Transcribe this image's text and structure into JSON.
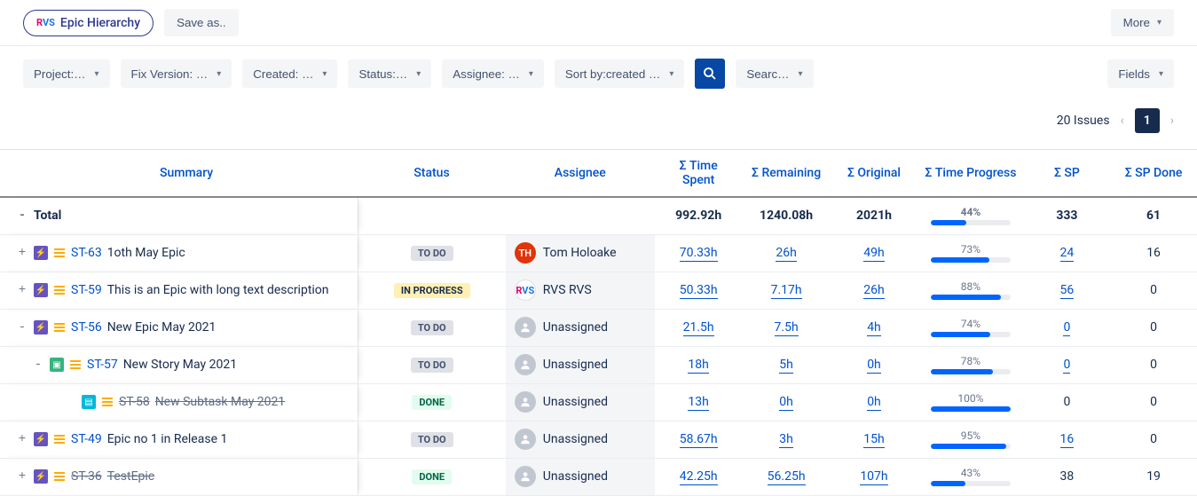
{
  "toolbar": {
    "title": "Epic Hierarchy",
    "saveas": "Save as..",
    "more": "More"
  },
  "filters": {
    "project": "Project:…",
    "fixversion": "Fix Version: …",
    "created": "Created: …",
    "status": "Status:…",
    "assignee": "Assignee: …",
    "sortby": "Sort by:created …",
    "search": "Searc…",
    "fields": "Fields"
  },
  "pagination": {
    "count": "20 Issues",
    "page": "1"
  },
  "headers": {
    "summary": "Summary",
    "status": "Status",
    "assignee": "Assignee",
    "timespent": "Σ Time Spent",
    "remaining": "Σ Remaining",
    "original": "Σ Original",
    "progress": "Σ Time Progress",
    "sp": "Σ SP",
    "spdone": "Σ SP Done"
  },
  "totals": {
    "label": "Total",
    "timespent": "992.92h",
    "remaining": "1240.08h",
    "original": "2021h",
    "progress": "44%",
    "progress_val": 44,
    "sp": "333",
    "spdone": "61"
  },
  "rows": [
    {
      "expander": "+",
      "indent": 0,
      "type": "epic",
      "key": "ST-63",
      "strike_key": false,
      "summary": "1oth May Epic",
      "strike_summary": false,
      "status": "TO DO",
      "status_kind": "todo",
      "assignee": "Tom Holoake",
      "avatar": "TH",
      "avatar_kind": "th",
      "timespent": "70.33h",
      "remaining": "26h",
      "original": "49h",
      "progress": "73%",
      "progress_val": 73,
      "sp": "24",
      "sp_link": true,
      "spdone": "16"
    },
    {
      "expander": "+",
      "indent": 0,
      "type": "epic",
      "key": "ST-59",
      "strike_key": false,
      "summary": "This is an Epic with long text description",
      "strike_summary": false,
      "status": "IN PROGRESS",
      "status_kind": "prog",
      "assignee": "RVS RVS",
      "avatar": "RVS",
      "avatar_kind": "rvs",
      "timespent": "50.33h",
      "remaining": "7.17h",
      "original": "26h",
      "progress": "88%",
      "progress_val": 88,
      "sp": "56",
      "sp_link": true,
      "spdone": "0"
    },
    {
      "expander": "-",
      "indent": 0,
      "type": "epic",
      "key": "ST-56",
      "strike_key": false,
      "summary": "New Epic May 2021",
      "strike_summary": false,
      "status": "TO DO",
      "status_kind": "todo",
      "assignee": "Unassigned",
      "avatar": "",
      "avatar_kind": "un",
      "timespent": "21.5h",
      "remaining": "7.5h",
      "original": "4h",
      "progress": "74%",
      "progress_val": 74,
      "sp": "0",
      "sp_link": true,
      "spdone": "0"
    },
    {
      "expander": "-",
      "indent": 1,
      "type": "story",
      "key": "ST-57",
      "strike_key": false,
      "summary": "New Story May 2021",
      "strike_summary": false,
      "status": "TO DO",
      "status_kind": "todo",
      "assignee": "Unassigned",
      "avatar": "",
      "avatar_kind": "un",
      "timespent": "18h",
      "remaining": "5h",
      "original": "0h",
      "progress": "78%",
      "progress_val": 78,
      "sp": "0",
      "sp_link": true,
      "spdone": "0"
    },
    {
      "expander": "",
      "indent": 2,
      "type": "sub",
      "key": "ST-58",
      "strike_key": true,
      "summary": "New Subtask May 2021",
      "strike_summary": true,
      "status": "DONE",
      "status_kind": "done",
      "assignee": "Unassigned",
      "avatar": "",
      "avatar_kind": "un",
      "timespent": "13h",
      "remaining": "0h",
      "original": "0h",
      "progress": "100%",
      "progress_val": 100,
      "sp": "0",
      "sp_link": false,
      "spdone": "0"
    },
    {
      "expander": "+",
      "indent": 0,
      "type": "epic",
      "key": "ST-49",
      "strike_key": false,
      "summary": "Epic no 1 in Release 1",
      "strike_summary": false,
      "status": "TO DO",
      "status_kind": "todo",
      "assignee": "Unassigned",
      "avatar": "",
      "avatar_kind": "un",
      "timespent": "58.67h",
      "remaining": "3h",
      "original": "15h",
      "progress": "95%",
      "progress_val": 95,
      "sp": "16",
      "sp_link": true,
      "spdone": "0"
    },
    {
      "expander": "+",
      "indent": 0,
      "type": "epic",
      "key": "ST-36",
      "strike_key": true,
      "summary": "TestEpic",
      "strike_summary": true,
      "status": "DONE",
      "status_kind": "done",
      "assignee": "Unassigned",
      "avatar": "",
      "avatar_kind": "un",
      "timespent": "42.25h",
      "remaining": "56.25h",
      "original": "107h",
      "progress": "43%",
      "progress_val": 43,
      "sp": "38",
      "sp_link": false,
      "spdone": "19"
    }
  ]
}
